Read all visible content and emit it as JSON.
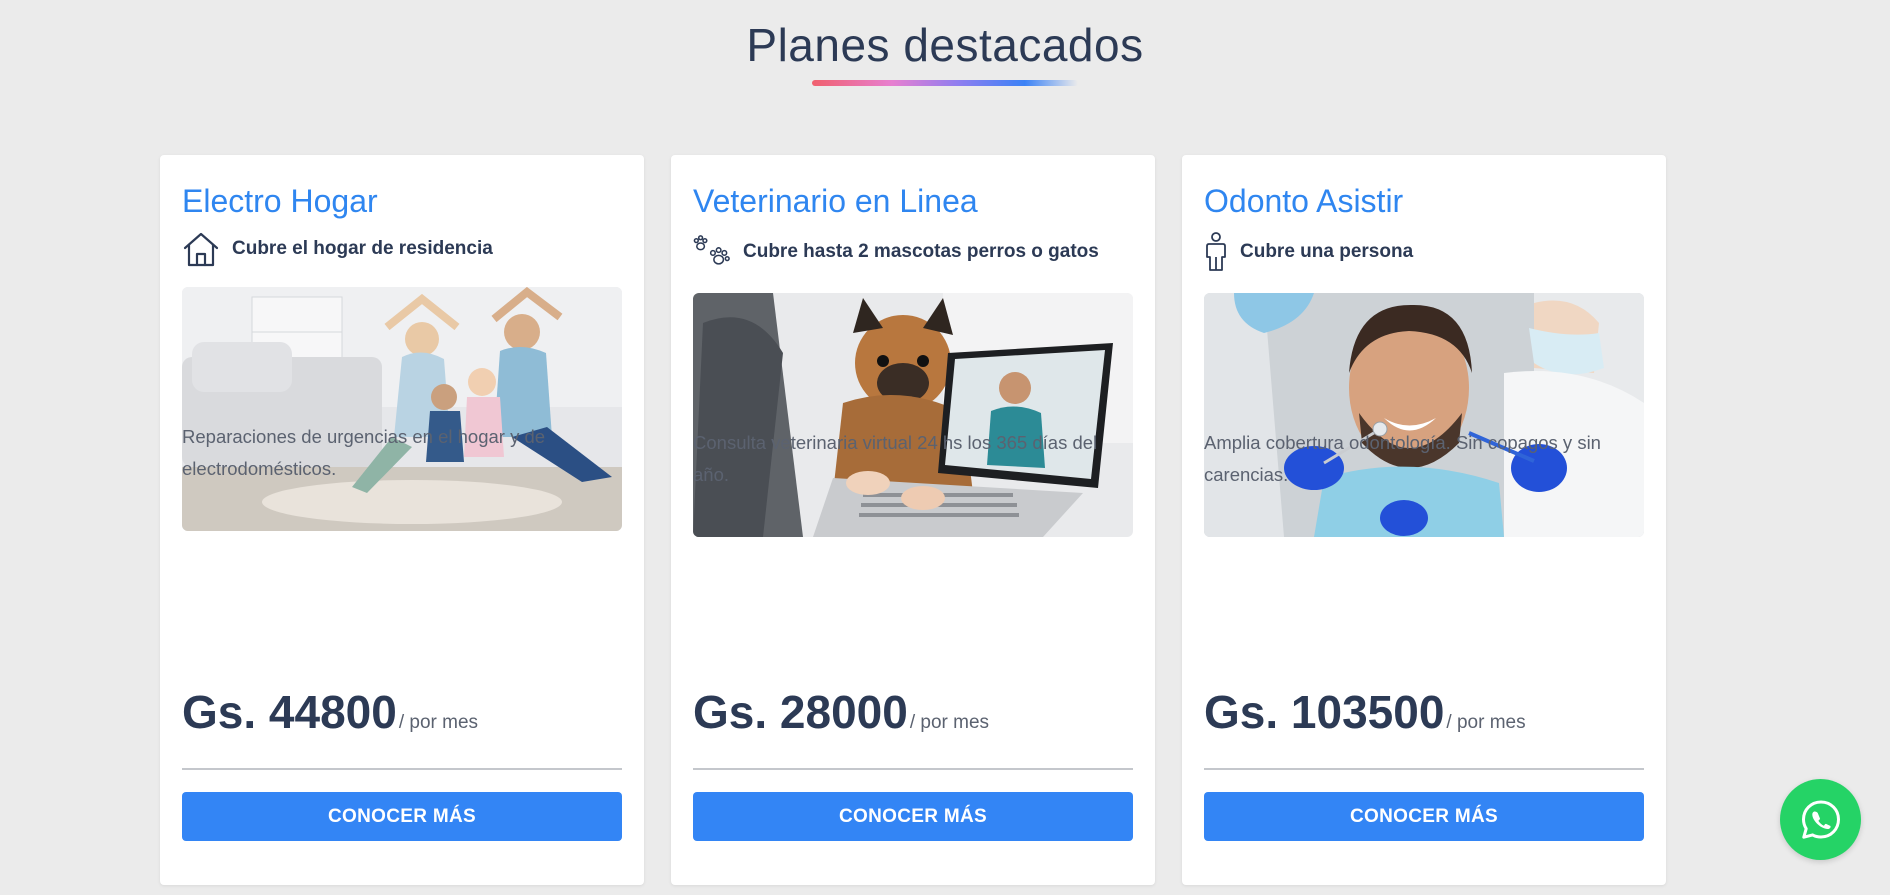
{
  "section": {
    "title": "Planes destacados"
  },
  "plans": [
    {
      "title": "Electro Hogar",
      "coverage": "Cubre el hogar de residencia",
      "coverage_icon": "house-icon",
      "image": "family-home-photo",
      "description": "Reparaciones de urgencias en el hogar y de electrodomésticos.",
      "price": "Gs. 44800",
      "period": "/ por mes",
      "cta": "CONOCER MÁS"
    },
    {
      "title": "Veterinario en Linea",
      "coverage": "Cubre hasta 2 mascotas perros o gatos",
      "coverage_icon": "paw-prints-icon",
      "image": "dog-vet-video-call-photo",
      "description": "Consulta veterinaria virtual 24 hs los 365 días del año.",
      "price": "Gs. 28000",
      "period": "/ por mes",
      "cta": "CONOCER MÁS"
    },
    {
      "title": "Odonto Asistir",
      "coverage": "Cubre una persona",
      "coverage_icon": "person-icon",
      "image": "dentist-patient-photo",
      "description": "Amplia cobertura odontología. Sin copagos y sin carencias.",
      "price": "Gs. 103500",
      "period": "/ por mes",
      "cta": "CONOCER MÁS"
    }
  ],
  "floating": {
    "icon": "whatsapp-icon"
  },
  "colors": {
    "background": "#ebebeb",
    "accent": "#3385f5",
    "title_blue": "#2f86f0",
    "heading": "#2c3a55",
    "whatsapp": "#25d366"
  }
}
